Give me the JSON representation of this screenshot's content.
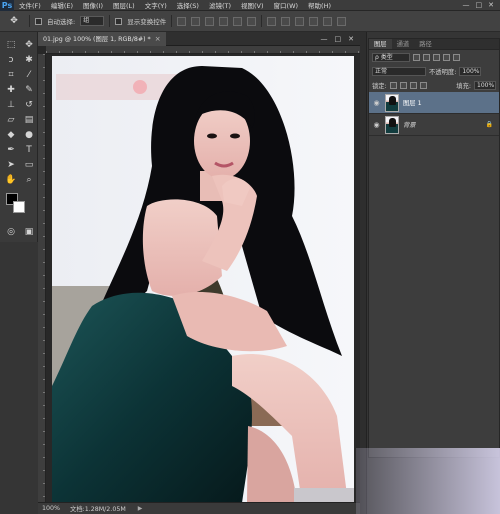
{
  "app": {
    "logo": "Ps",
    "accent": "#4aa3f0"
  },
  "menu": [
    "文件(F)",
    "编辑(E)",
    "图像(I)",
    "图层(L)",
    "文字(Y)",
    "选择(S)",
    "滤镜(T)",
    "视图(V)",
    "窗口(W)",
    "帮助(H)"
  ],
  "window_controls": [
    "—",
    "□",
    "✕"
  ],
  "options_bar": {
    "auto_select_label": "自动选择:",
    "auto_select_value": "组",
    "show_transform_label": "显示变换控件"
  },
  "document": {
    "tab_title": "01.jpg @ 100% (图层 1, RGB/8#) *",
    "tab_close": "×",
    "controls": [
      "—",
      "□",
      "✕"
    ]
  },
  "status": {
    "zoom": "100%",
    "doc_info": "文档:1.28M/2.05M",
    "arrow": "▶"
  },
  "layers_panel": {
    "tabs": [
      "图层",
      "通道",
      "路径"
    ],
    "filter_kind": "ρ 类型",
    "blend_mode": "正常",
    "opacity_label": "不透明度:",
    "opacity_value": "100%",
    "lock_label": "锁定:",
    "fill_label": "填充:",
    "fill_value": "100%",
    "layers": [
      {
        "name": "图层 1",
        "selected": true
      },
      {
        "name": "背景",
        "selected": false,
        "locked": true
      }
    ]
  },
  "icons": {
    "visibility": "eye-icon",
    "lock": "lock-icon",
    "move_tool": "move-tool-icon"
  }
}
